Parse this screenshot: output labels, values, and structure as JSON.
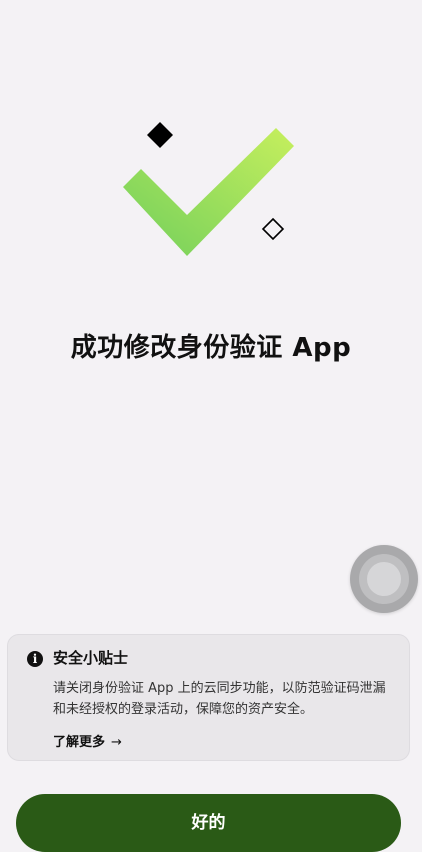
{
  "page": {
    "title": "成功修改身份验证 App"
  },
  "illustration": {
    "check_icon": "checkmark-icon",
    "accent_colors": [
      "#7fd35e",
      "#c4ee5c"
    ]
  },
  "tip": {
    "icon": "info-icon",
    "icon_glyph": "i",
    "title": "安全小贴士",
    "body": "请关闭身份验证 App 上的云同步功能，以防范验证码泄漏和未经授权的登录活动，保障您的资产安全。",
    "link_label": "了解更多",
    "link_arrow": "→"
  },
  "actions": {
    "ok_label": "好的",
    "ok_color": "#2a5a16"
  }
}
